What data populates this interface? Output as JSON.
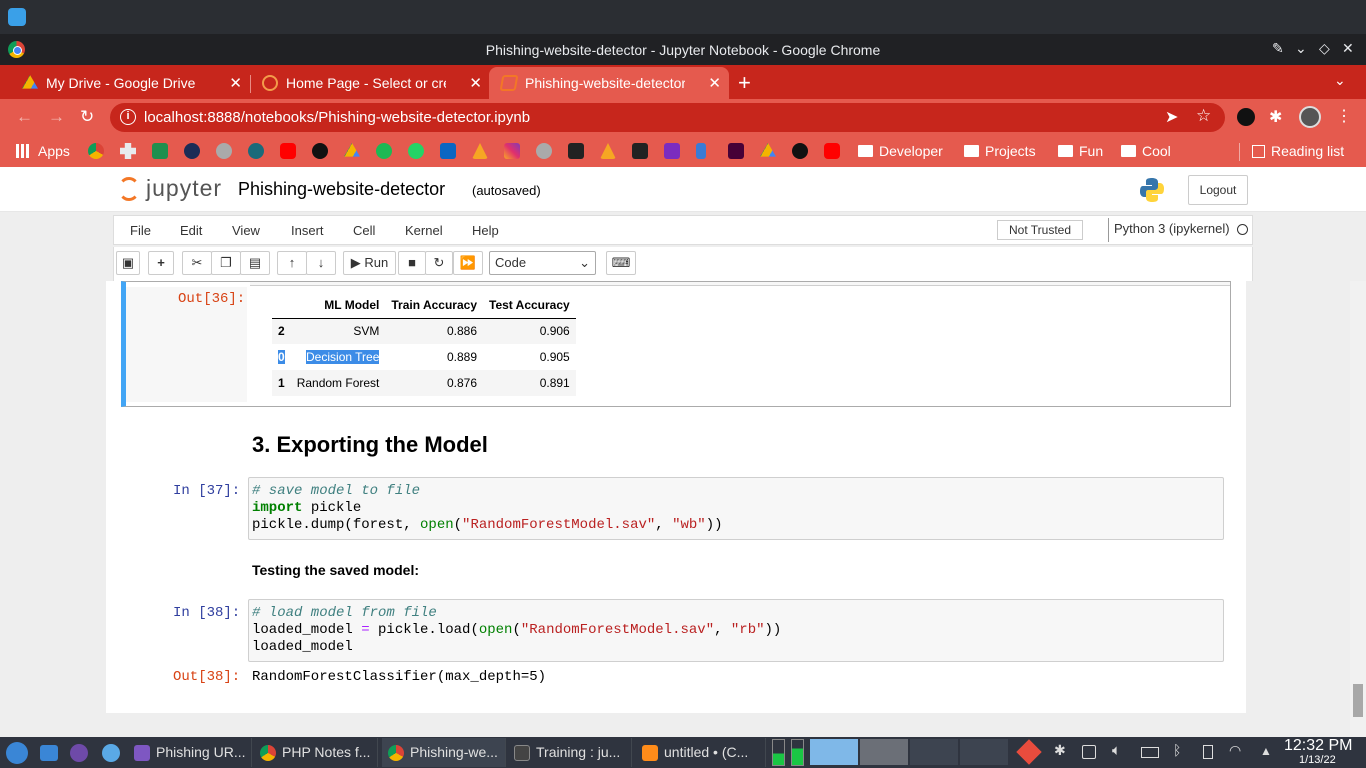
{
  "window": {
    "title": "Phishing-website-detector - Jupyter Notebook - Google Chrome"
  },
  "tabs": [
    {
      "label": "My Drive - Google Drive"
    },
    {
      "label": "Home Page - Select or crea"
    },
    {
      "label": "Phishing-website-detector"
    }
  ],
  "omnibox": {
    "url": "localhost:8888/notebooks/Phishing-website-detector.ipynb"
  },
  "bookmarks": {
    "apps": "Apps",
    "folders": [
      "Developer",
      "Projects",
      "Fun",
      "Cool"
    ],
    "reading_list": "Reading list"
  },
  "jupyter": {
    "logo_text": "jupyter",
    "notebook_name": "Phishing-website-detector",
    "autosave": "(autosaved)",
    "logout": "Logout",
    "menus": [
      "File",
      "Edit",
      "View",
      "Insert",
      "Cell",
      "Kernel",
      "Help"
    ],
    "trusted": "Not Trusted",
    "kernel": "Python 3 (ipykernel)",
    "run_label": "Run",
    "cell_type": "Code"
  },
  "notebook": {
    "out36_prompt": "Out[36]:",
    "table": {
      "headers": [
        "",
        "ML Model",
        "Train Accuracy",
        "Test Accuracy"
      ],
      "rows": [
        [
          "2",
          "SVM",
          "0.886",
          "0.906"
        ],
        [
          "0",
          "Decision Tree",
          "0.889",
          "0.905"
        ],
        [
          "1",
          "Random Forest",
          "0.876",
          "0.891"
        ]
      ]
    },
    "heading": "3. Exporting the Model",
    "in37_prompt": "In [37]:",
    "in37_code": {
      "comment": "# save model to file",
      "kw_import": "import",
      "module": " pickle",
      "line3_a": "pickle.dump(forest, ",
      "line3_open": "open",
      "line3_b": "(",
      "line3_s1": "\"RandomForestModel.sav\"",
      "line3_c": ", ",
      "line3_s2": "\"wb\"",
      "line3_d": "))"
    },
    "testing_text": "Testing the saved model:",
    "in38_prompt": "In [38]:",
    "in38_code": {
      "comment": "# load model from file",
      "l2_a": "loaded_model ",
      "l2_eq": "=",
      "l2_b": " pickle.load(",
      "l2_open": "open",
      "l2_c": "(",
      "l2_s1": "\"RandomForestModel.sav\"",
      "l2_d": ", ",
      "l2_s2": "\"rb\"",
      "l2_e": "))",
      "l3": "loaded_model"
    },
    "out38_prompt": "Out[38]:",
    "out38_text": "RandomForestClassifier(max_depth=5)"
  },
  "taskbar": {
    "tasks": [
      "Phishing UR...",
      "PHP Notes f...",
      "Phishing-we...",
      "Training : ju...",
      "untitled • (C..."
    ],
    "time": "12:32 PM",
    "date": "1/13/22"
  }
}
